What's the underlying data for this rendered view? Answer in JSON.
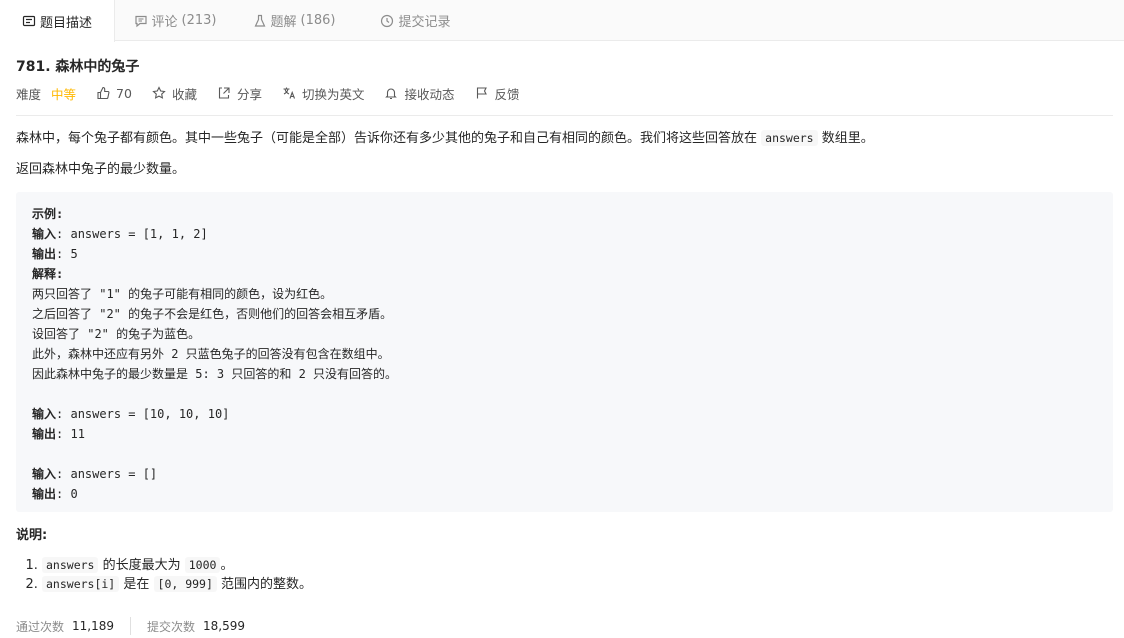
{
  "tabs": [
    {
      "label": "题目描述",
      "count": "",
      "icon": "description-icon"
    },
    {
      "label": "评论",
      "count": "(213)",
      "icon": "comment-icon"
    },
    {
      "label": "题解",
      "count": "(186)",
      "icon": "flask-icon"
    },
    {
      "label": "提交记录",
      "count": "",
      "icon": "clock-icon"
    }
  ],
  "problem": {
    "title": "781. 森林中的兔子",
    "difficulty_label": "难度",
    "difficulty": "中等",
    "difficulty_color": "#ffb800",
    "likes": "70",
    "favorite": "收藏",
    "share": "分享",
    "translate": "切换为英文",
    "subscribe": "接收动态",
    "feedback": "反馈"
  },
  "description": {
    "p1_before": "森林中，每个兔子都有颜色。其中一些兔子（可能是全部）告诉你还有多少其他的兔子和自己有相同的颜色。我们将这些回答放在 ",
    "p1_code": "answers",
    "p1_after": " 数组里。",
    "p2": "返回森林中兔子的最少数量。"
  },
  "example": {
    "heading": "示例:",
    "in_label": "输入",
    "out_label": "输出",
    "explain_label": "解释",
    "ex1_input": ": answers = [1, 1, 2]",
    "ex1_output": ": 5",
    "explain_colon": ":",
    "explain_lines": [
      "两只回答了 \"1\" 的兔子可能有相同的颜色，设为红色。",
      "之后回答了 \"2\" 的兔子不会是红色，否则他们的回答会相互矛盾。",
      "设回答了 \"2\" 的兔子为蓝色。",
      "此外，森林中还应有另外 2 只蓝色兔子的回答没有包含在数组中。",
      "因此森林中兔子的最少数量是 5: 3 只回答的和 2 只没有回答的。"
    ],
    "ex2_input": ": answers = [10, 10, 10]",
    "ex2_output": ": 11",
    "ex3_input": ": answers = []",
    "ex3_output": ": 0"
  },
  "notes": {
    "title": "说明:",
    "n1_code1": "answers",
    "n1_mid": " 的长度最大为 ",
    "n1_code2": "1000",
    "n1_end": "。",
    "n2_code1": "answers[i]",
    "n2_mid": " 是在 ",
    "n2_code2": "[0, 999]",
    "n2_end": " 范围内的整数。"
  },
  "stats": {
    "accepted_label": "通过次数",
    "accepted": "11,189",
    "submitted_label": "提交次数",
    "submitted": "18,599"
  }
}
